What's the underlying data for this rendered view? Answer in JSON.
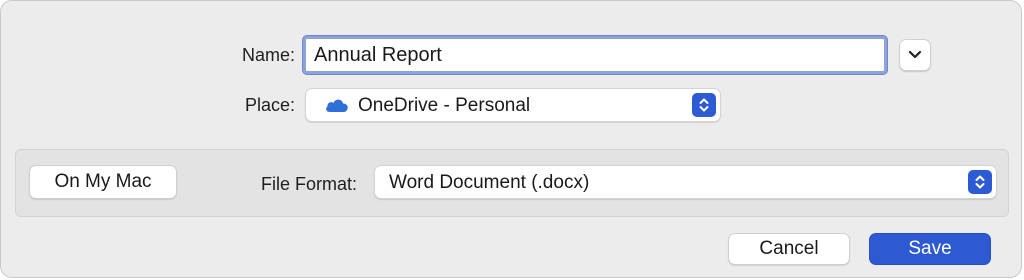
{
  "name_field": {
    "label": "Name:",
    "value": "Annual Report"
  },
  "place": {
    "label": "Place:",
    "selected": "OneDrive - Personal",
    "icon": "cloud-icon"
  },
  "sidebar_button": {
    "label": "On My Mac"
  },
  "file_format": {
    "label": "File Format:",
    "selected": "Word Document (.docx)"
  },
  "buttons": {
    "cancel": "Cancel",
    "save": "Save"
  },
  "colors": {
    "accent": "#2d59d3",
    "focus_ring": "#8ea4d9",
    "cloud": "#2f6fd8"
  }
}
